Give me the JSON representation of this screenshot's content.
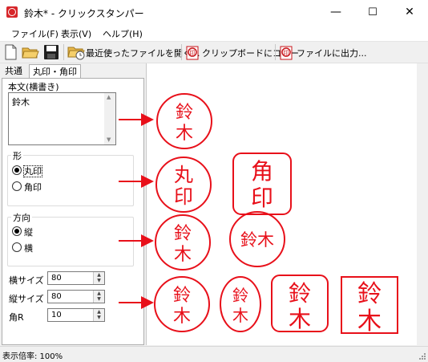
{
  "window": {
    "title": "鈴木* - クリックスタンパー",
    "minimize": "—",
    "maximize": "☐",
    "close": "✕"
  },
  "menu": [
    {
      "label": "ファイル(F)"
    },
    {
      "label": "表示(V)"
    },
    {
      "label": "ヘルプ(H)"
    }
  ],
  "toolbar": {
    "recent_label": "最近使ったファイルを開く...",
    "clipboard_label": "クリップボードにコピー",
    "export_label": "ファイルに出力..."
  },
  "tabs": {
    "common": "共通",
    "shape": "丸印・角印"
  },
  "panel": {
    "body_label": "本文(横書き)",
    "body_text": "鈴木",
    "shape": {
      "label": "形",
      "options": [
        "丸印",
        "角印"
      ],
      "selected": "丸印"
    },
    "direction": {
      "label": "方向",
      "options": [
        "縦",
        "横"
      ],
      "selected": "縦"
    },
    "width": {
      "label": "横サイズ",
      "value": "80"
    },
    "height": {
      "label": "縦サイズ",
      "value": "80"
    },
    "radius": {
      "label": "角R",
      "value": "10"
    }
  },
  "stamps": {
    "suzuki_top": "鈴",
    "suzuki_bottom": "木",
    "round_top": "丸",
    "round_bottom": "印",
    "square_top": "角",
    "square_bottom": "印",
    "horizontal": "鈴木"
  },
  "status": {
    "zoom": "表示倍率: 100%"
  },
  "colors": {
    "stamp_red": "#e8101a",
    "arrow_red": "#e8101a"
  }
}
